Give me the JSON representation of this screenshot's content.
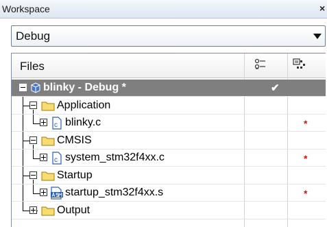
{
  "window": {
    "title": "Workspace",
    "close_glyph": "×"
  },
  "config": {
    "selected": "Debug"
  },
  "tree": {
    "header": {
      "files_label": "Files",
      "col1_icon": "options-icon",
      "col2_icon": "build-status-icon"
    },
    "rows": [
      {
        "label": "blinky - Debug *",
        "type": "project",
        "expander": "minus",
        "checked": true,
        "selected": true
      },
      {
        "label": "Application",
        "type": "group",
        "expander": "minus"
      },
      {
        "label": "blinky.c",
        "type": "c-file",
        "expander": "plus",
        "star": "*"
      },
      {
        "label": "CMSIS",
        "type": "group",
        "expander": "minus"
      },
      {
        "label": "system_stm32f4xx.c",
        "type": "c-file",
        "expander": "plus",
        "star": "*"
      },
      {
        "label": "Startup",
        "type": "group",
        "expander": "minus"
      },
      {
        "label": "startup_stm32f4xx.s",
        "type": "asm-file",
        "expander": "plus",
        "star": "*"
      },
      {
        "label": "Output",
        "type": "group",
        "expander": "plus"
      }
    ],
    "check_glyph": "✔"
  },
  "colors": {
    "selection": "#7f7f7f",
    "folder_fill": "#f7dc6f",
    "file_icon": "#2a5db0",
    "star": "#d21414"
  }
}
